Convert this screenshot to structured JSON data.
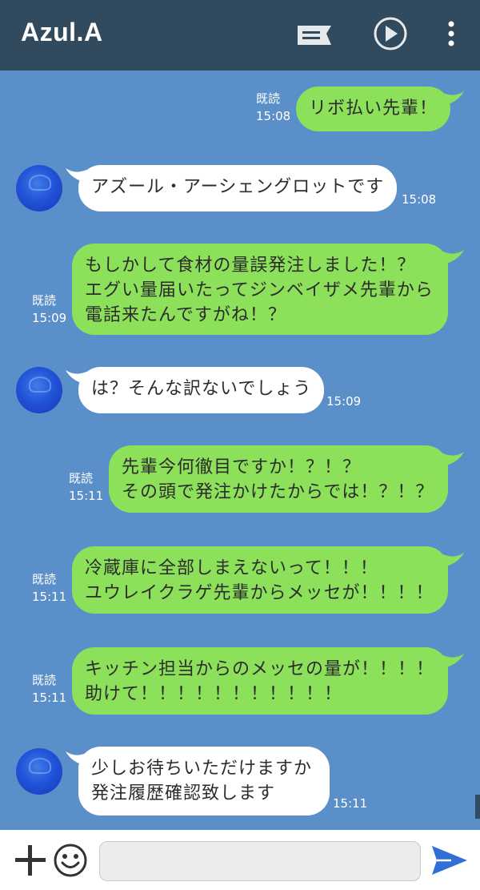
{
  "header": {
    "title": "Azul.A",
    "icons": [
      "notes-icon",
      "play-icon",
      "more-vert-icon"
    ]
  },
  "messages": [
    {
      "side": "out",
      "lines": [
        "リボ払い先輩！"
      ],
      "read": "既読",
      "time": "15:08"
    },
    {
      "side": "in",
      "lines": [
        "アズール・アーシェングロットです"
      ],
      "time": "15:08"
    },
    {
      "side": "out",
      "lines": [
        "もしかして食材の量誤発注しました！？",
        "エグい量届いたってジンベイザメ先輩から",
        "電話来たんですがね！？"
      ],
      "read": "既読",
      "time": "15:09"
    },
    {
      "side": "in",
      "lines": [
        "は？そんな訳ないでしょう"
      ],
      "time": "15:09"
    },
    {
      "side": "out",
      "lines": [
        "先輩今何徹目ですか！？！？",
        "その頭で発注かけたからでは！？！？"
      ],
      "read": "既読",
      "time": "15:11"
    },
    {
      "side": "out",
      "lines": [
        "冷蔵庫に全部しまえないって！！！",
        "ユウレイクラゲ先輩からメッセが！！！！"
      ],
      "read": "既読",
      "time": "15:11"
    },
    {
      "side": "out",
      "lines": [
        "キッチン担当からのメッセの量が！！！！",
        "助けて！！！！！！！！！！！"
      ],
      "read": "既読",
      "time": "15:11"
    },
    {
      "side": "in",
      "lines": [
        "少しお待ちいただけますか",
        "発注履歴確認致します"
      ],
      "time": "15:11"
    }
  ],
  "composer": {
    "value": "",
    "placeholder": ""
  },
  "colors": {
    "header_bg": "#324a5e",
    "chat_bg": "#5b8fca",
    "outgoing_bubble": "#8de05a",
    "incoming_bubble": "#ffffff",
    "send_accent": "#2f6fd6"
  }
}
